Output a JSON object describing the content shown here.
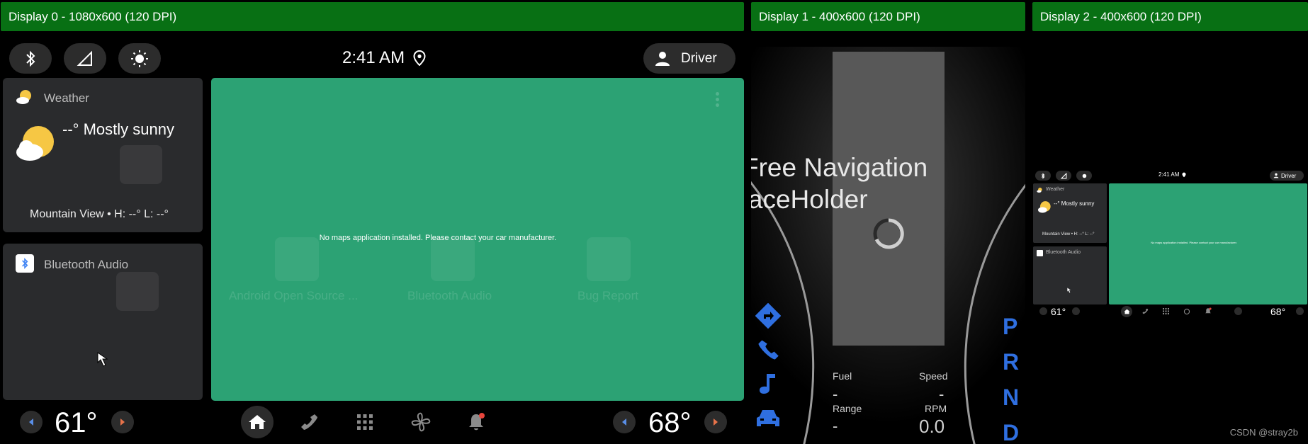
{
  "displays": [
    {
      "title": "Display 0 - 1080x600 (120 DPI)"
    },
    {
      "title": "Display 1 - 400x600 (120 DPI)"
    },
    {
      "title": "Display 2 - 400x600 (120 DPI)"
    }
  ],
  "status_bar": {
    "time": "2:41 AM",
    "user": "Driver",
    "icons": [
      "bluetooth-icon",
      "signal-icon",
      "brightness-icon",
      "location-icon",
      "person-icon"
    ]
  },
  "weather_card": {
    "title": "Weather",
    "condition": "--° Mostly sunny",
    "location": "Mountain View • H: --° L: --°"
  },
  "bluetooth_card": {
    "title": "Bluetooth Audio"
  },
  "map": {
    "message": "No maps application installed. Please contact your car manufacturer.",
    "ghost_apps": [
      "Android Open Source ...",
      "Bluetooth Audio",
      "Bug Report"
    ]
  },
  "bottom_bar": {
    "left_temp": "61°",
    "right_temp": "68°",
    "nav_icons": [
      "home-icon",
      "phone-icon",
      "apps-grid-icon",
      "fan-icon",
      "notification-bell-icon"
    ]
  },
  "cluster": {
    "nav_placeholder_line1": "Free Navigation",
    "nav_placeholder_line2": "PlaceHolder",
    "fuel_label": "Fuel",
    "fuel_value": "-",
    "speed_label": "Speed",
    "speed_value": "-",
    "range_label": "Range",
    "range_value": "-",
    "rpm_label": "RPM",
    "rpm_value": "0.0",
    "gears": [
      "P",
      "R",
      "N",
      "D"
    ]
  },
  "mini": {
    "time": "2:41 AM",
    "user": "Driver",
    "weather_title": "Weather",
    "weather_condition": "--° Mostly sunny",
    "weather_location": "Mountain View • H: --° L: --°",
    "bluetooth_title": "Bluetooth Audio",
    "map_message": "No maps application installed. Please contact your car manufacturer.",
    "left_temp": "61°",
    "right_temp": "68°"
  },
  "watermark": "CSDN @stray2b",
  "colors": {
    "titlebar": "#087014",
    "map_green": "#2ca274",
    "card_bg": "#2a2b2d",
    "gear_blue": "#2f6fe0",
    "nav_blue": "#2f6fe0",
    "sun_yellow": "#f6c744"
  }
}
